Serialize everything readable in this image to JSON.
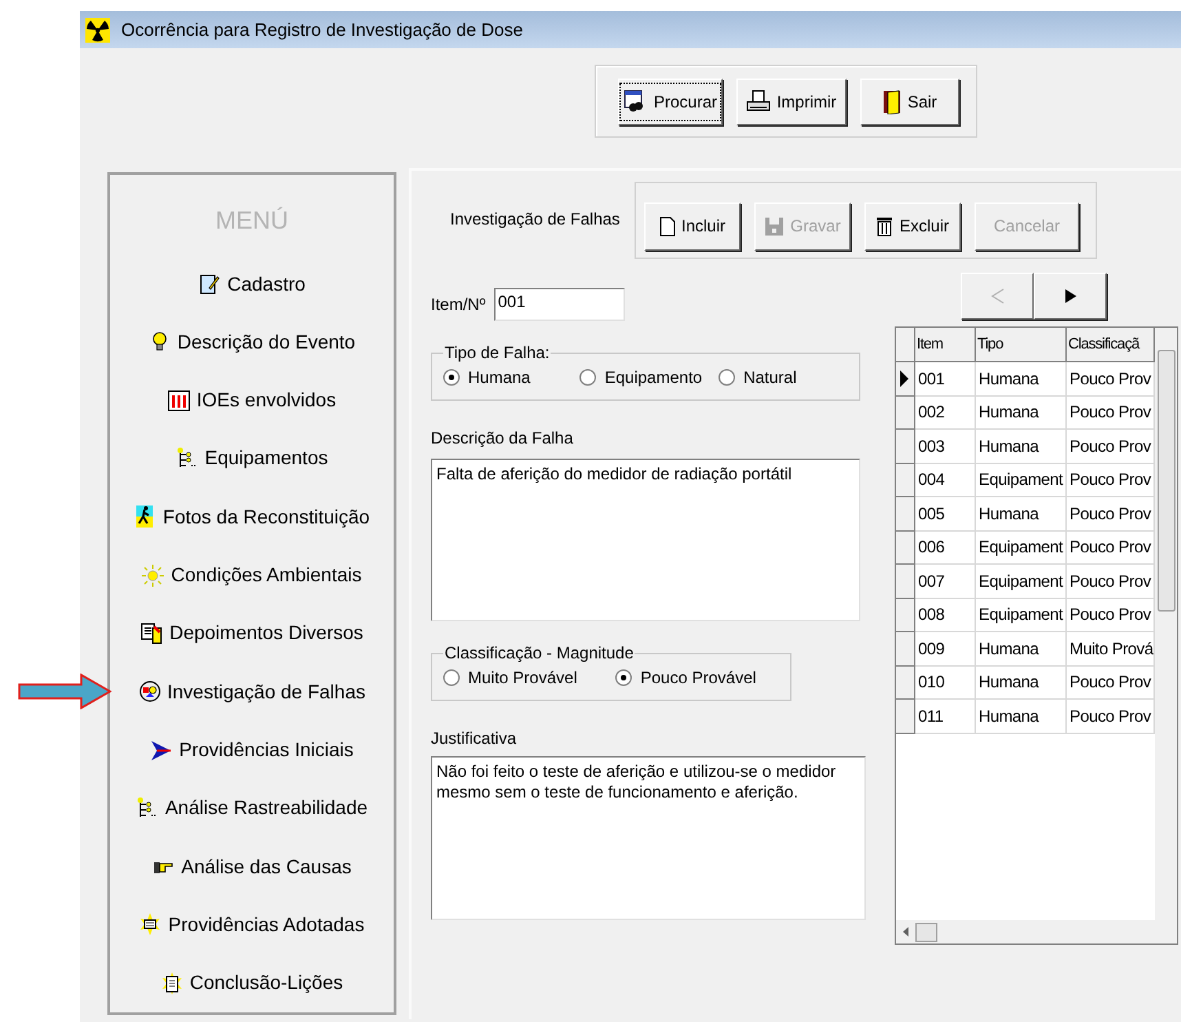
{
  "window": {
    "title": "Ocorrência para Registro de Investigação de Dose"
  },
  "toolbar": {
    "buttons": [
      {
        "label": "Procurar",
        "focused": true
      },
      {
        "label": "Imprimir",
        "focused": false
      },
      {
        "label": "Sair",
        "focused": false
      }
    ]
  },
  "menu": {
    "title": "MENÚ",
    "items": [
      {
        "label": "Cadastro",
        "pointed": false
      },
      {
        "label": "Descrição do Evento",
        "pointed": false
      },
      {
        "label": "IOEs envolvidos",
        "pointed": false
      },
      {
        "label": "Equipamentos",
        "pointed": false
      },
      {
        "label": "Fotos da Reconstituição",
        "pointed": false
      },
      {
        "label": "Condições Ambientais",
        "pointed": false
      },
      {
        "label": "Depoimentos Diversos",
        "pointed": false
      },
      {
        "label": "Investigação de Falhas",
        "pointed": true
      },
      {
        "label": "Providências Iniciais",
        "pointed": false
      },
      {
        "label": "Análise Rastreabilidade",
        "pointed": false
      },
      {
        "label": "Análise das Causas",
        "pointed": false
      },
      {
        "label": "Providências Adotadas",
        "pointed": false
      },
      {
        "label": "Conclusão-Lições",
        "pointed": false
      }
    ]
  },
  "section": {
    "title": "Investigação de Falhas",
    "buttons": [
      {
        "label": "Incluir",
        "disabled": false
      },
      {
        "label": "Gravar",
        "disabled": true
      },
      {
        "label": "Excluir",
        "disabled": false
      },
      {
        "label": "Cancelar",
        "disabled": true
      }
    ]
  },
  "item_field": {
    "label": "Item/Nº",
    "value": "001"
  },
  "tipo_de_falha": {
    "legend": "Tipo de Falha:",
    "options": [
      {
        "label": "Humana",
        "selected": true
      },
      {
        "label": "Equipamento",
        "selected": false
      },
      {
        "label": "Natural",
        "selected": false
      }
    ]
  },
  "descricao": {
    "label": "Descrição da Falha",
    "value": "Falta de aferição do medidor de radiação portátil"
  },
  "classificacao": {
    "legend": "Classificação - Magnitude",
    "options": [
      {
        "label": "Muito Provável",
        "selected": false
      },
      {
        "label": "Pouco Provável",
        "selected": true
      }
    ]
  },
  "justificativa": {
    "label": "Justificativa",
    "value": "Não foi feito o teste de aferição e utilizou-se o medidor mesmo sem o teste de funcionamento e aferição."
  },
  "navigation": {
    "previous": {
      "disabled": true
    },
    "next": {
      "disabled": false
    }
  },
  "table": {
    "columns": [
      "Item",
      "Tipo",
      "Classificaçã"
    ],
    "rows": [
      {
        "cells": [
          "001",
          "Humana",
          "Pouco Prov"
        ],
        "selected": true
      },
      {
        "cells": [
          "002",
          "Humana",
          "Pouco Prov"
        ],
        "selected": false
      },
      {
        "cells": [
          "003",
          "Humana",
          "Pouco Prov"
        ],
        "selected": false
      },
      {
        "cells": [
          "004",
          "Equipament",
          "Pouco Prov"
        ],
        "selected": false
      },
      {
        "cells": [
          "005",
          "Humana",
          "Pouco Prov"
        ],
        "selected": false
      },
      {
        "cells": [
          "006",
          "Equipament",
          "Pouco Prov"
        ],
        "selected": false
      },
      {
        "cells": [
          "007",
          "Equipament",
          "Pouco Prov"
        ],
        "selected": false
      },
      {
        "cells": [
          "008",
          "Equipament",
          "Pouco Prov"
        ],
        "selected": false
      },
      {
        "cells": [
          "009",
          "Humana",
          "Muito Prová"
        ],
        "selected": false
      },
      {
        "cells": [
          "010",
          "Humana",
          "Pouco Prov"
        ],
        "selected": false
      },
      {
        "cells": [
          "011",
          "Humana",
          "Pouco Prov"
        ],
        "selected": false
      }
    ]
  }
}
